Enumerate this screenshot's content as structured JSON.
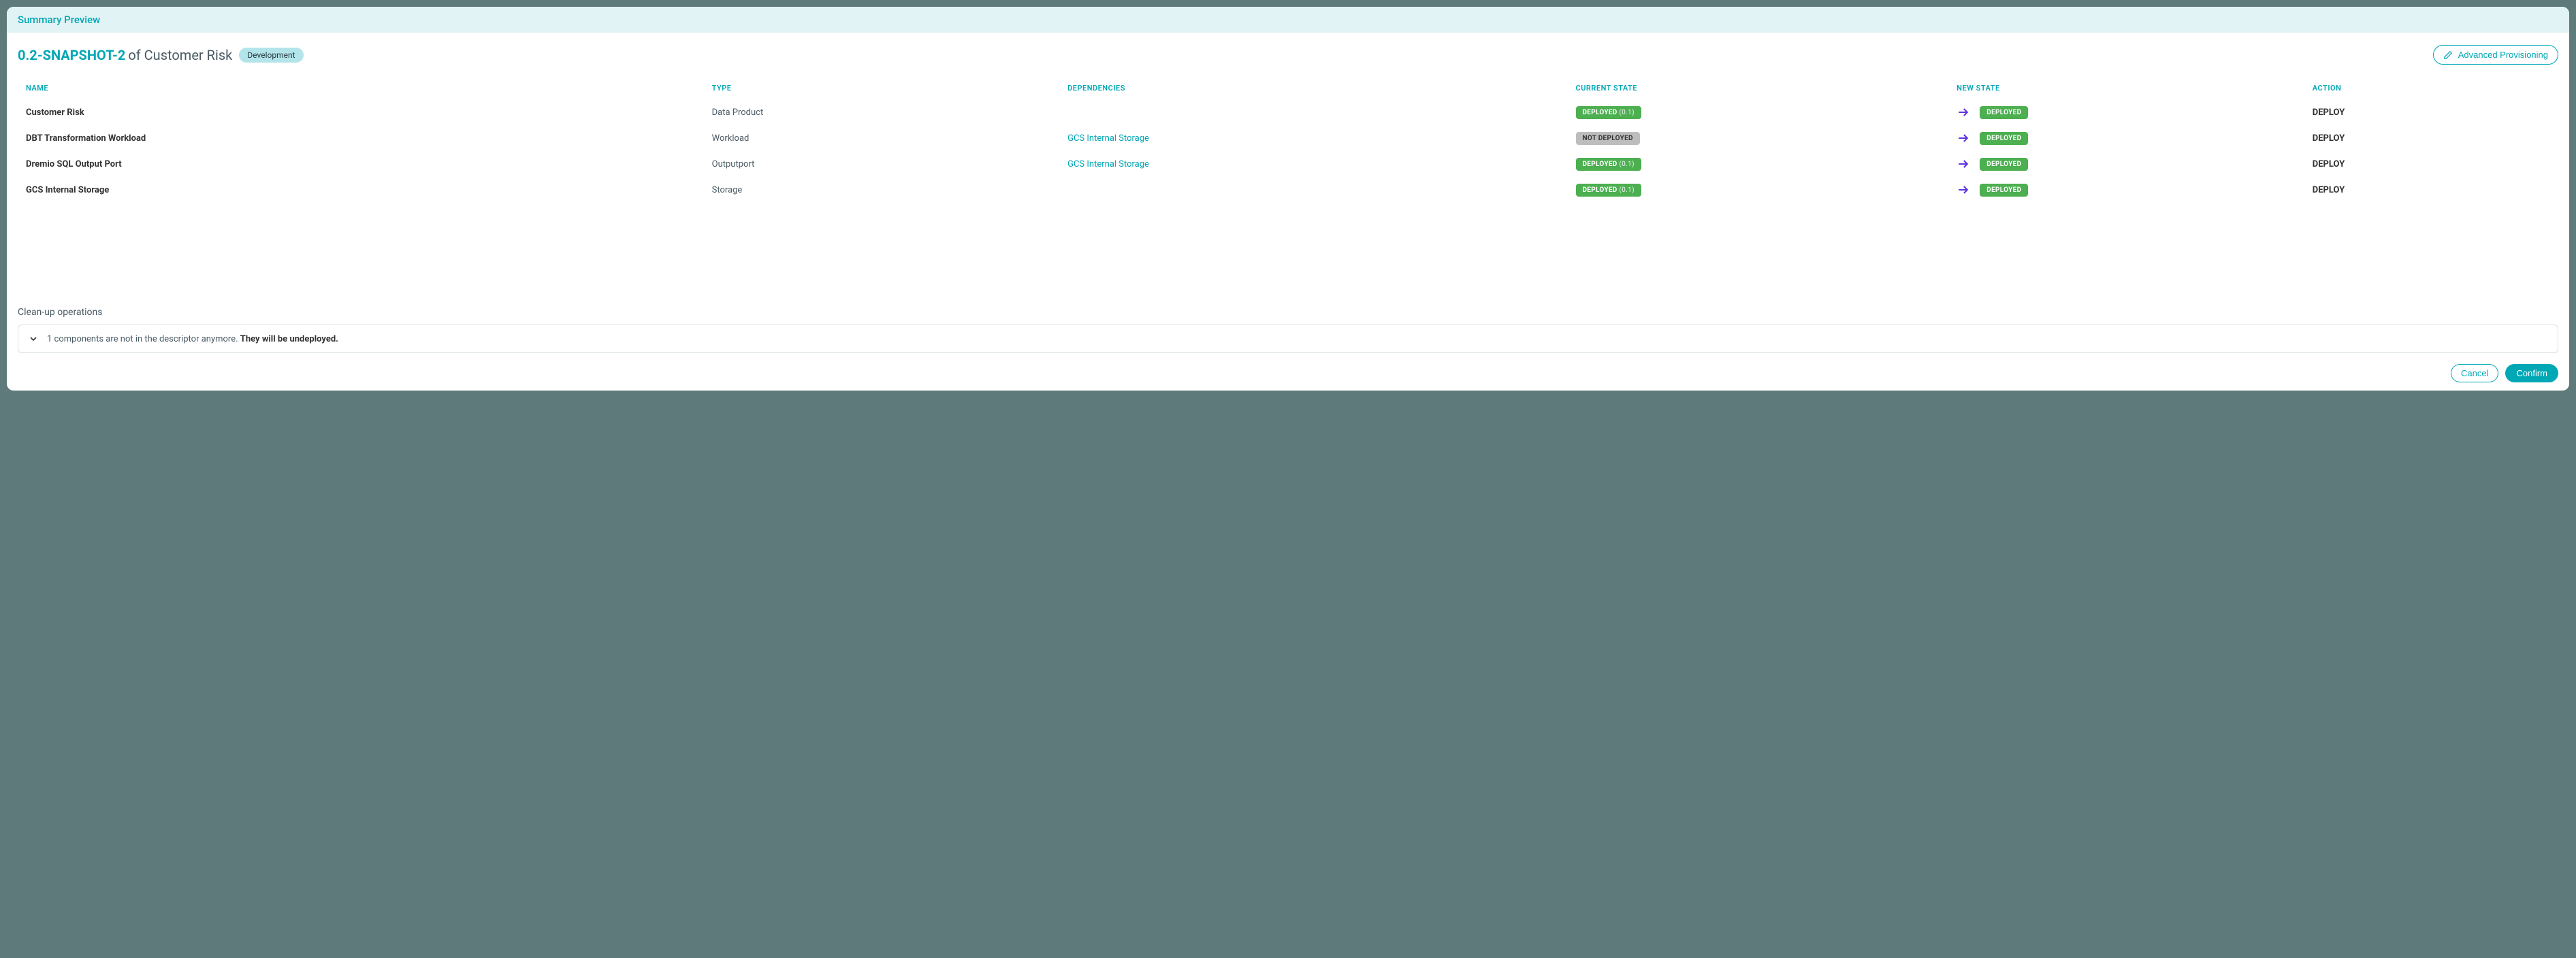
{
  "header": {
    "title": "Summary Preview"
  },
  "page": {
    "version": "0.2-SNAPSHOT-2",
    "of_label": "of",
    "entity": "Customer Risk",
    "env_chip": "Development",
    "advanced_btn": "Advanced Provisioning"
  },
  "table": {
    "headers": {
      "name": "NAME",
      "type": "TYPE",
      "dependencies": "DEPENDENCIES",
      "current_state": "CURRENT STATE",
      "new_state": "NEW STATE",
      "action": "ACTION"
    },
    "rows": [
      {
        "name": "Customer Risk",
        "type": "Data Product",
        "dependency": "",
        "current": {
          "text": "DEPLOYED",
          "version": "(0.1)",
          "style": "green"
        },
        "new": {
          "text": "DEPLOYED",
          "style": "green"
        },
        "action": "DEPLOY"
      },
      {
        "name": "DBT Transformation Workload",
        "type": "Workload",
        "dependency": "GCS Internal Storage",
        "current": {
          "text": "NOT DEPLOYED",
          "version": "",
          "style": "grey"
        },
        "new": {
          "text": "DEPLOYED",
          "style": "green"
        },
        "action": "DEPLOY"
      },
      {
        "name": "Dremio SQL Output Port",
        "type": "Outputport",
        "dependency": "GCS Internal Storage",
        "current": {
          "text": "DEPLOYED",
          "version": "(0.1)",
          "style": "green"
        },
        "new": {
          "text": "DEPLOYED",
          "style": "green"
        },
        "action": "DEPLOY"
      },
      {
        "name": "GCS Internal Storage",
        "type": "Storage",
        "dependency": "",
        "current": {
          "text": "DEPLOYED",
          "version": "(0.1)",
          "style": "green"
        },
        "new": {
          "text": "DEPLOYED",
          "style": "green"
        },
        "action": "DEPLOY"
      }
    ]
  },
  "cleanup": {
    "title": "Clean-up operations",
    "message_prefix": "1 components are not in the descriptor anymore. ",
    "message_bold": "They will be undeployed."
  },
  "footer": {
    "cancel": "Cancel",
    "confirm": "Confirm"
  }
}
